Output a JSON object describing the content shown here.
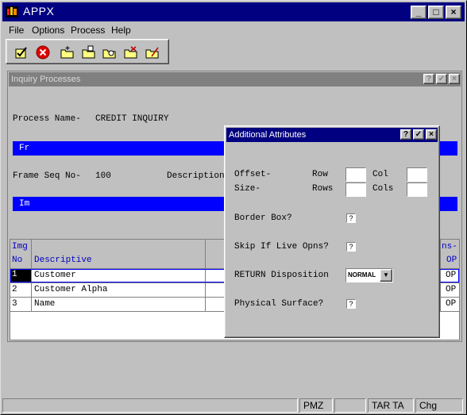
{
  "app": {
    "title": "APPX"
  },
  "menu": [
    {
      "label": "File"
    },
    {
      "label": "Options"
    },
    {
      "label": "Process"
    },
    {
      "label": "Help"
    }
  ],
  "toolbar": {
    "icons": [
      "checkmark-icon",
      "cancel-icon",
      "new-folder-icon",
      "open-folder-icon",
      "search-folder-icon",
      "delete-folder-icon",
      "tools-folder-icon"
    ]
  },
  "inquiry": {
    "title": "Inquiry Processes",
    "process_name_label": "Process Name-",
    "process_name_value": "CREDIT INQUIRY",
    "frame_bar_label": "Fr",
    "frame_seq_label": "Frame Seq No-",
    "frame_seq_value": "100",
    "description_label": "Description",
    "image_bar_label": "Im",
    "table": {
      "header_line1_col1": "Img",
      "header_line2_col1": "No",
      "header_col2": "Descriptive",
      "header_line1_last": "ns-",
      "header_line2_last": "OP",
      "rows": [
        {
          "no": "1",
          "desc": "Customer",
          "op": "OP"
        },
        {
          "no": "2",
          "desc": "Customer Alpha",
          "op": "OP"
        },
        {
          "no": "3",
          "desc": "Name",
          "op": "OP"
        }
      ]
    }
  },
  "dialog": {
    "title": "Additional Attributes",
    "offset_label": "Offset-",
    "size_label": "Size-",
    "row_label": "Row",
    "col_label": "Col",
    "rows_label": "Rows",
    "cols_label": "Cols",
    "border_box_label": "Border Box?",
    "skip_label": "Skip If Live Opns?",
    "return_label": "RETURN Disposition",
    "return_value": "NORMAL",
    "physical_label": "Physical Surface?",
    "question_mark": "?"
  },
  "status": {
    "cells": [
      "PMZ",
      "TAR TA",
      "Chg"
    ]
  }
}
